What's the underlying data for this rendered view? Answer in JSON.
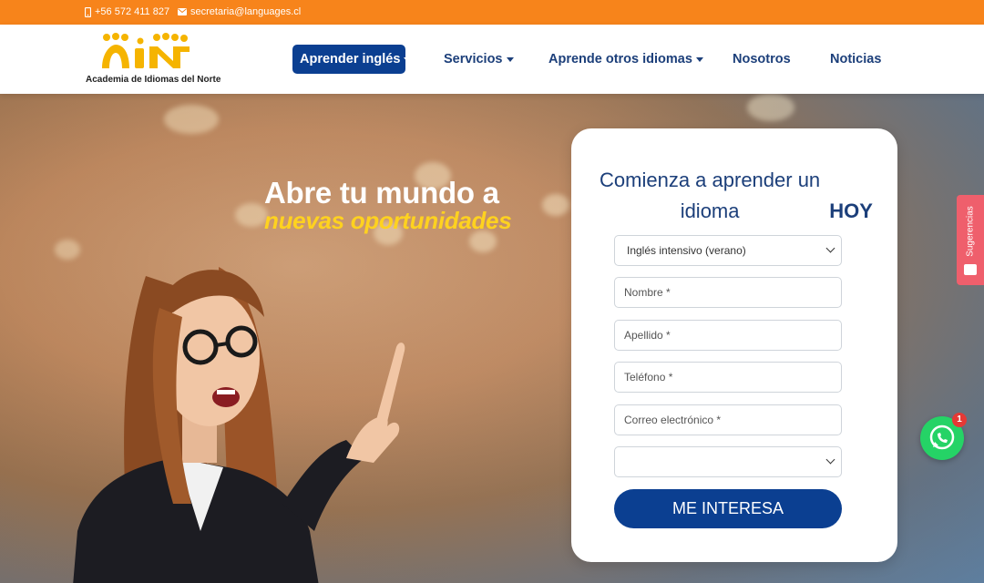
{
  "topbar": {
    "phone": "+56 572 411 827",
    "email": "secretaria@languages.cl",
    "phone_icon": "phone-icon",
    "email_icon": "envelope-icon",
    "bg_color": "#f7841b"
  },
  "logo": {
    "mark": "AIN",
    "name": "Academia de Idiomas del Norte"
  },
  "nav": {
    "items": [
      {
        "label": "Aprender inglés",
        "dropdown": true,
        "active": true
      },
      {
        "label": "Servicios",
        "dropdown": true
      },
      {
        "label": "Aprende otros idiomas",
        "dropdown": true
      },
      {
        "label": "Nosotros"
      },
      {
        "label": "Noticias"
      }
    ]
  },
  "hero": {
    "headline": "Abre tu mundo a",
    "subline": "nuevas oportunidades"
  },
  "form": {
    "title_part1": "Comienza a aprender un idioma",
    "title_bold": "HOY",
    "course_select_value": "Inglés intensivo (verano)",
    "fields": [
      {
        "placeholder": "Nombre *"
      },
      {
        "placeholder": "Apellido *"
      },
      {
        "placeholder": "Teléfono *"
      },
      {
        "placeholder": "Correo electrónico *"
      }
    ],
    "second_select_value": "",
    "submit_label": "ME INTERESA"
  },
  "side_tab": {
    "label": "Sugerencias"
  },
  "whatsapp": {
    "icon": "whatsapp-icon",
    "badge_count": "1"
  },
  "colors": {
    "accent_orange": "#f7841b",
    "brand_blue": "#0b3f91",
    "highlight_yellow": "#ffd21f",
    "whatsapp_green": "#25d366"
  }
}
